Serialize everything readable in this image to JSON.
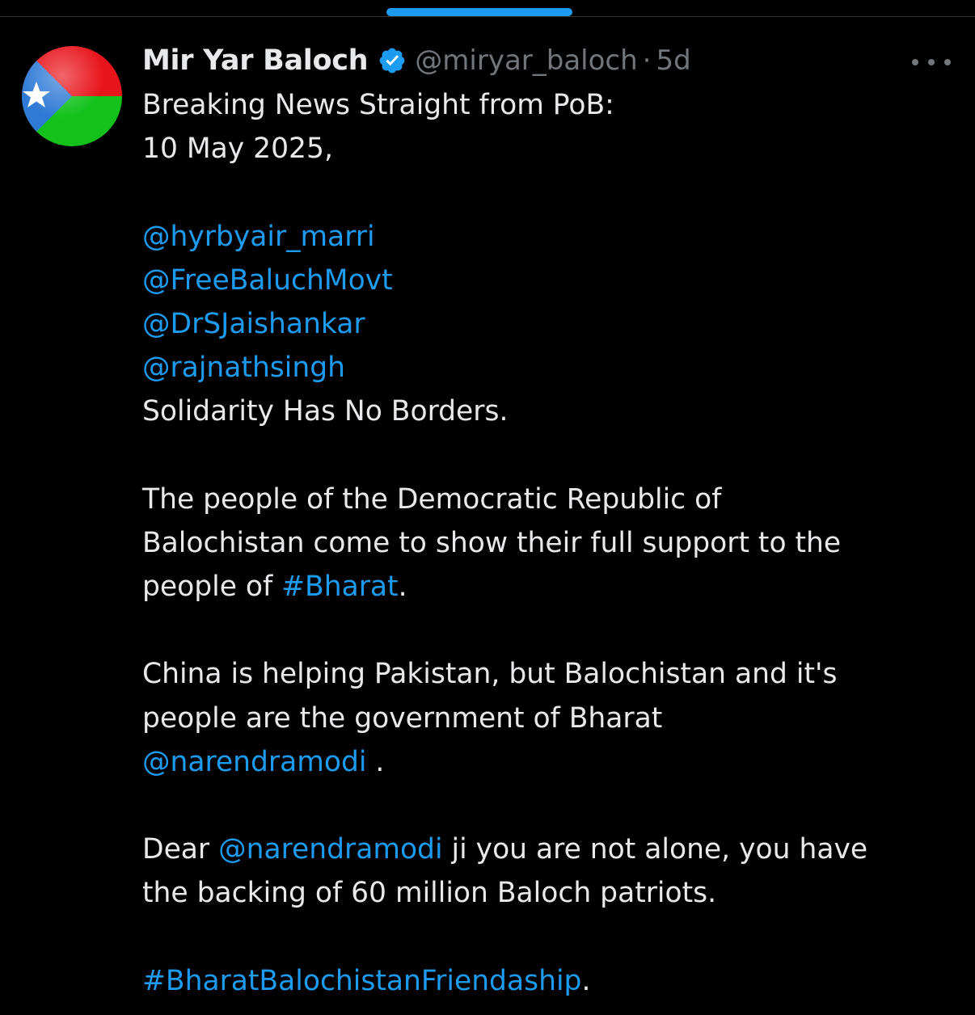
{
  "tweet": {
    "author": {
      "display_name": "Mir Yar Baloch",
      "handle": "@miryar_baloch",
      "verified_icon": "verified-badge-icon",
      "avatar": "balochistan-flag-avatar"
    },
    "separator": "·",
    "timestamp": "5d",
    "more_icon": "more-options-icon",
    "lines": {
      "l1": "Breaking News Straight from PoB:",
      "l2": "10 May 2025,",
      "mention1": "@hyrbyair_marri",
      "mention2": "@FreeBaluchMovt",
      "mention3": "@DrSJaishankar",
      "mention4": "@rajnathsingh",
      "l3": "Solidarity Has No Borders.",
      "p2_l1": "The people of the Democratic Republic of",
      "p2_l2": "Balochistan come to show their full support to the",
      "p2_l3_pre": "people of ",
      "p2_l3_tag": "#Bharat",
      "p2_l3_post": ".",
      "p3_l1": "China is helping Pakistan, but Balochistan and it's",
      "p3_l2": "people are the government of Bharat",
      "p3_l3_mention": "@narendramodi",
      "p3_l3_post": " .",
      "p4_l1_pre": "Dear ",
      "p4_l1_mention": "@narendramodi",
      "p4_l1_post": " ji you are not alone, you have",
      "p4_l2": "the backing of 60 million Baloch patriots.",
      "p5_tag": "#BharatBalochistanFriendaship",
      "p5_post": "."
    }
  },
  "colors": {
    "background": "#000000",
    "text": "#e7e9ea",
    "muted": "#71767b",
    "link": "#1d9bf0",
    "verified": "#1d9bf0"
  }
}
